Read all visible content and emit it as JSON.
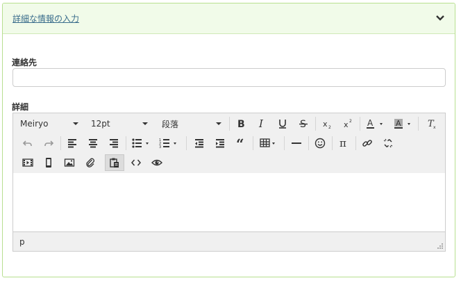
{
  "panel": {
    "title": "詳細な情報の入力"
  },
  "form": {
    "contact_label": "連絡先",
    "contact_value": "",
    "details_label": "詳細"
  },
  "toolbar": {
    "font_family": "Meiryo",
    "font_size": "12pt",
    "block_format": "段落",
    "buttons_row1": [
      "bold-icon",
      "italic-icon",
      "underline-icon",
      "strikethrough-icon",
      "subscript-icon",
      "superscript-icon",
      "text-color-icon",
      "background-color-icon",
      "clear-formatting-icon"
    ],
    "buttons_row2": [
      "undo-icon",
      "redo-icon",
      "align-left-icon",
      "align-center-icon",
      "align-right-icon",
      "bullet-list-icon",
      "numbered-list-icon",
      "outdent-icon",
      "indent-icon",
      "blockquote-icon",
      "table-icon",
      "horizontal-rule-icon",
      "emoticon-icon",
      "pi-icon",
      "link-icon",
      "unlink-icon"
    ],
    "buttons_row3": [
      "media-icon",
      "mobile-icon",
      "image-icon",
      "attachment-icon",
      "paste-icon",
      "code-icon",
      "preview-icon"
    ]
  },
  "statusbar": {
    "path": "p"
  },
  "colors": {
    "panel_border": "#b7df8f",
    "panel_header_bg": "#f1fbe9",
    "link": "#3a6d8c",
    "toolbar_bg": "#f0f0f0"
  }
}
